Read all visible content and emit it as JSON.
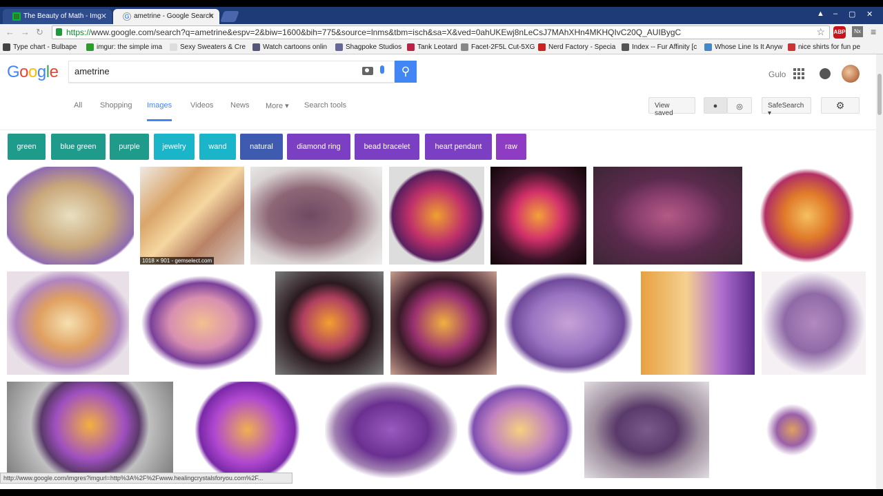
{
  "tabs": [
    {
      "title": "The Beauty of Math - Img",
      "active": false
    },
    {
      "title": "ametrine - Google Search",
      "active": true
    }
  ],
  "window_controls": {
    "user_icon": "person-icon",
    "minimize": "–",
    "maximize": "▢",
    "close": "✕"
  },
  "address_bar": {
    "scheme": "https://",
    "url": "www.google.com/search?q=ametrine&espv=2&biw=1600&bih=775&source=lnms&tbm=isch&sa=X&ved=0ahUKEwj8nLeCsJ7MAhXHn4MKHQIvC20Q_AUIBygC"
  },
  "extensions": [
    "ABP",
    "Nx"
  ],
  "bookmarks": [
    {
      "label": "Type chart - Bulbape",
      "color": "#444"
    },
    {
      "label": "imgur: the simple ima",
      "color": "#2a9d2a"
    },
    {
      "label": "Sexy Sweaters & Cre",
      "color": "#ddd"
    },
    {
      "label": "Watch cartoons onlin",
      "color": "#557"
    },
    {
      "label": "Shagpoke Studios",
      "color": "#669"
    },
    {
      "label": "Tank Leotard",
      "color": "#b24"
    },
    {
      "label": "Facet-2F5L Cut-5XG",
      "color": "#888"
    },
    {
      "label": "Nerd Factory - Specia",
      "color": "#c22"
    },
    {
      "label": "Index -- Fur Affinity [c",
      "color": "#555"
    },
    {
      "label": "Whose Line Is It Anyw",
      "color": "#48c"
    },
    {
      "label": "nice shirts for fun pe",
      "color": "#c33"
    }
  ],
  "google": {
    "logo": [
      {
        "ch": "G",
        "color": "#4285f4"
      },
      {
        "ch": "o",
        "color": "#ea4335"
      },
      {
        "ch": "o",
        "color": "#fbbc05"
      },
      {
        "ch": "g",
        "color": "#4285f4"
      },
      {
        "ch": "l",
        "color": "#34a853"
      },
      {
        "ch": "e",
        "color": "#ea4335"
      }
    ],
    "query": "ametrine",
    "user_name": "Gulo"
  },
  "nav_tabs": [
    "All",
    "Shopping",
    "Images",
    "Videos",
    "News",
    "More ▾",
    "Search tools"
  ],
  "view_saved": "View saved",
  "safesearch": "SafeSearch ▾",
  "chips": [
    {
      "label": "green",
      "color": "#1e9b8a"
    },
    {
      "label": "blue green",
      "color": "#1e9b8a"
    },
    {
      "label": "purple",
      "color": "#1e9b8a"
    },
    {
      "label": "jewelry",
      "color": "#1ab5c9"
    },
    {
      "label": "wand",
      "color": "#1ab5c9"
    },
    {
      "label": "natural",
      "color": "#3f5bb0"
    },
    {
      "label": "diamond ring",
      "color": "#7b3fc4"
    },
    {
      "label": "bead bracelet",
      "color": "#7b3fc4"
    },
    {
      "label": "heart pendant",
      "color": "#7b3fc4"
    },
    {
      "label": "raw",
      "color": "#8e3cc4"
    }
  ],
  "image_caption": "1018 × 901 - gemselect.com",
  "status_url": "http://www.google.com/imgres?imgurl=http%3A%2F%2Fwww.healingcrystalsforyou.com%2F..."
}
